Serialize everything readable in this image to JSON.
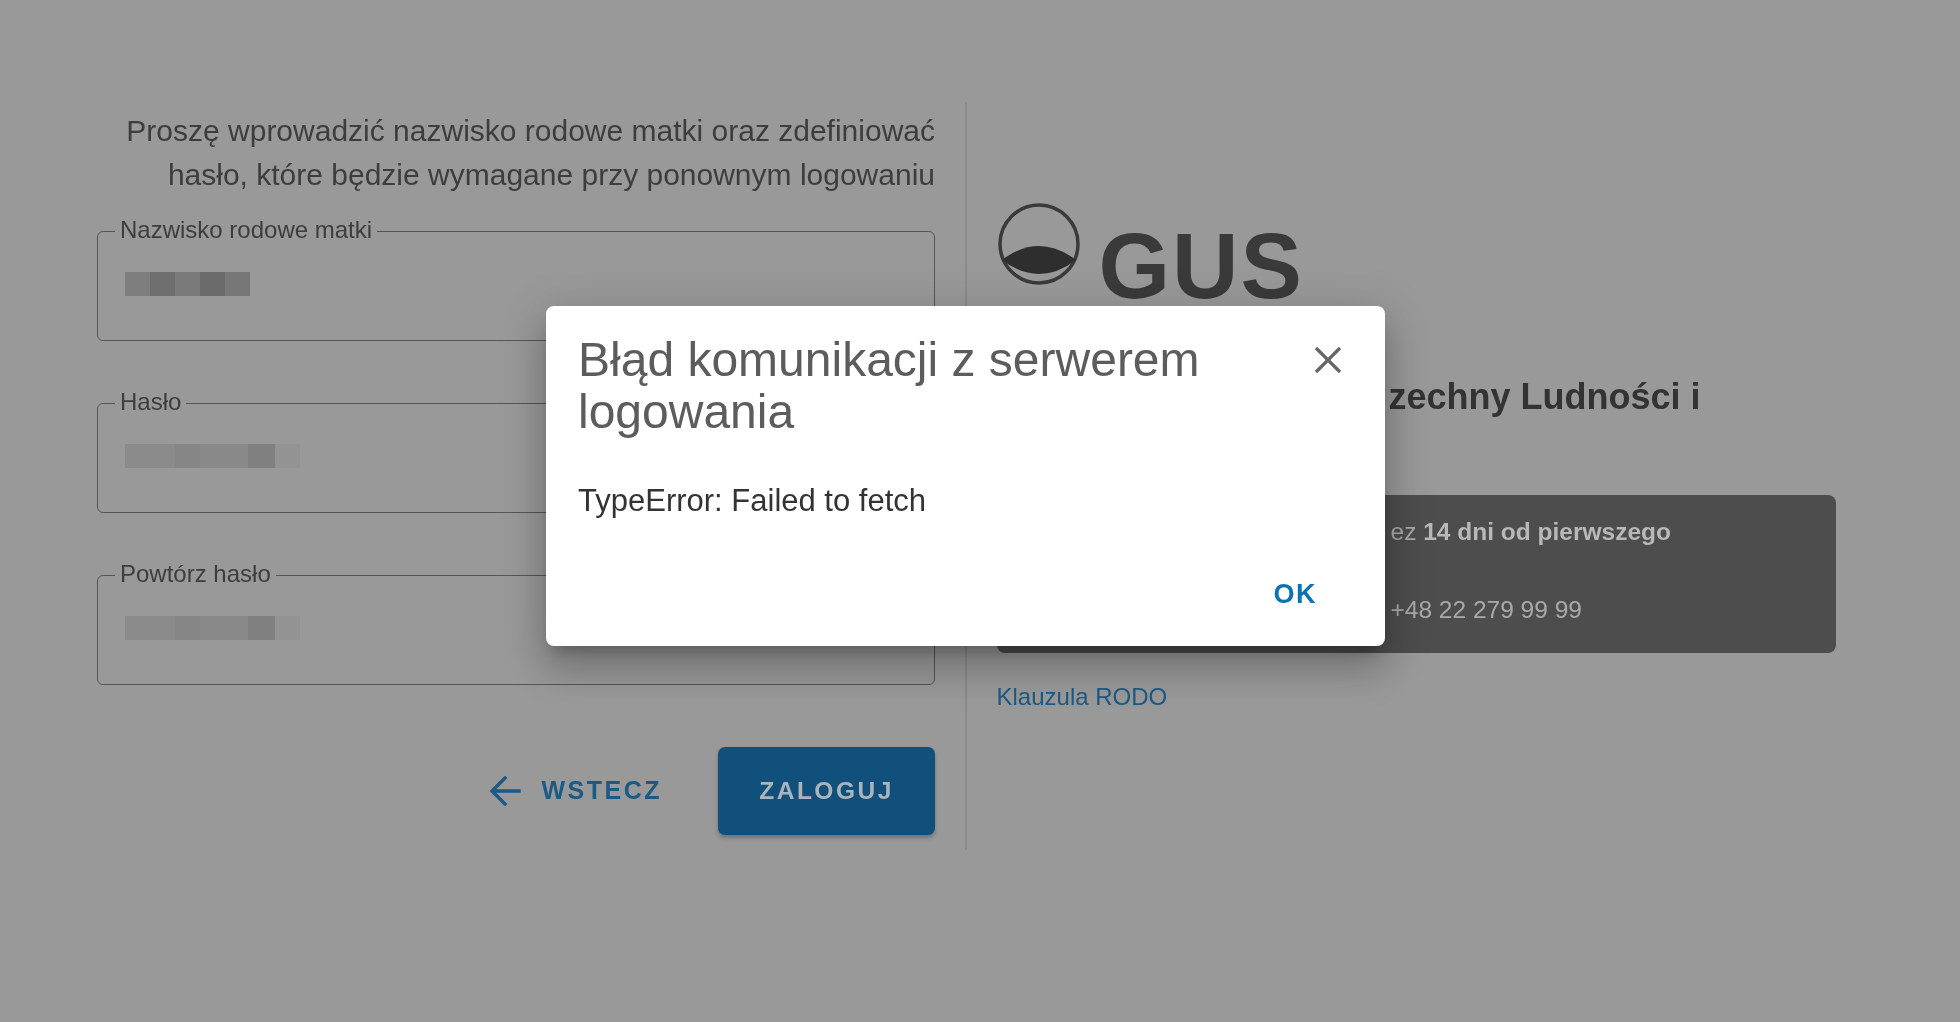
{
  "instruction": "Proszę wprowadzić nazwisko rodowe matki oraz zdefiniować hasło, które będzie wymagane przy ponownym logowaniu",
  "form": {
    "fields": [
      {
        "label": "Nazwisko rodowe matki"
      },
      {
        "label": "Hasło"
      },
      {
        "label": "Powtórz hasło"
      }
    ]
  },
  "buttons": [
    {
      "kind": "text",
      "label": "WSTECZ"
    },
    {
      "kind": "contained",
      "label": "ZALOGUJ"
    }
  ],
  "side_panel": {
    "logo": {
      "text": "GUS"
    },
    "heading": "zechny Ludności i",
    "notice": {
      "lines": [
        "ez **14 dni od pierwszego**",
        "+48 22 279 99 99"
      ]
    },
    "link": "Klauzula RODO"
  },
  "dialog": {
    "title": "Błąd komunikacji z serwerem logowania",
    "message": "TypeError: Failed to fetch",
    "buttons": [
      "OK"
    ]
  }
}
